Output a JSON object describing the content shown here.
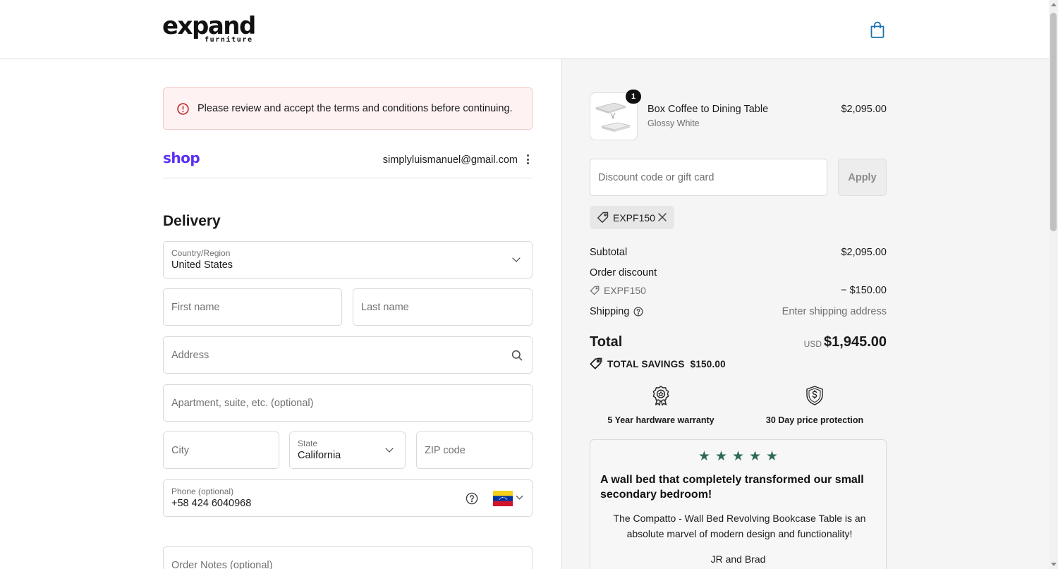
{
  "header": {
    "logo_word": "expand",
    "logo_sub": "furniture",
    "cart_icon": "shopping-bag-icon"
  },
  "alert": {
    "icon": "alert-circle-icon",
    "message": "Please review and accept the terms and conditions before continuing."
  },
  "account": {
    "shop_logo": "shop",
    "email": "simplyluismanuel@gmail.com",
    "menu_icon": "kebab-menu-icon"
  },
  "delivery": {
    "title": "Delivery",
    "country": {
      "label": "Country/Region",
      "value": "United States"
    },
    "first_name": {
      "placeholder": "First name"
    },
    "last_name": {
      "placeholder": "Last name"
    },
    "address": {
      "placeholder": "Address",
      "icon": "search-icon"
    },
    "apartment": {
      "placeholder": "Apartment, suite, etc. (optional)"
    },
    "city": {
      "placeholder": "City"
    },
    "state": {
      "label": "State",
      "value": "California"
    },
    "zip": {
      "placeholder": "ZIP code"
    },
    "phone": {
      "label": "Phone (optional)",
      "value": "+58 424 6040968",
      "help_icon": "question-circle-icon",
      "country_flag": "venezuela-flag-icon"
    },
    "order_notes": {
      "placeholder": "Order Notes (optional)"
    }
  },
  "summary": {
    "product": {
      "quantity": "1",
      "name": "Box Coffee to Dining Table",
      "variant": "Glossy White",
      "price": "$2,095.00"
    },
    "discount": {
      "placeholder": "Discount code or gift card",
      "apply_label": "Apply",
      "applied_code": "EXPF150"
    },
    "rows": {
      "subtotal_label": "Subtotal",
      "subtotal_value": "$2,095.00",
      "order_discount_label": "Order discount",
      "discount_code": "EXPF150",
      "discount_value": "− $150.00",
      "shipping_label": "Shipping",
      "shipping_value": "Enter shipping address"
    },
    "total": {
      "label": "Total",
      "currency": "USD",
      "amount": "$1,945.00",
      "savings_label": "TOTAL SAVINGS",
      "savings_value": "$150.00"
    },
    "badges": [
      {
        "icon": "award-ribbon-icon",
        "label": "5 Year hardware warranty"
      },
      {
        "icon": "shield-dollar-icon",
        "label": "30 Day price protection"
      }
    ],
    "review": {
      "stars": "★★★★★",
      "rating": 5,
      "title": "A wall bed that completely transformed our small secondary bedroom!",
      "body": "The Compatto - Wall Bed Revolving Bookcase Table is an absolute marvel of modern design and functionality!",
      "author": "JR and Brad"
    }
  },
  "colors": {
    "accent_blue": "#1773b0",
    "shop_purple": "#5a31f4",
    "error_red": "#c3262b",
    "star_green": "#2e6b57"
  }
}
